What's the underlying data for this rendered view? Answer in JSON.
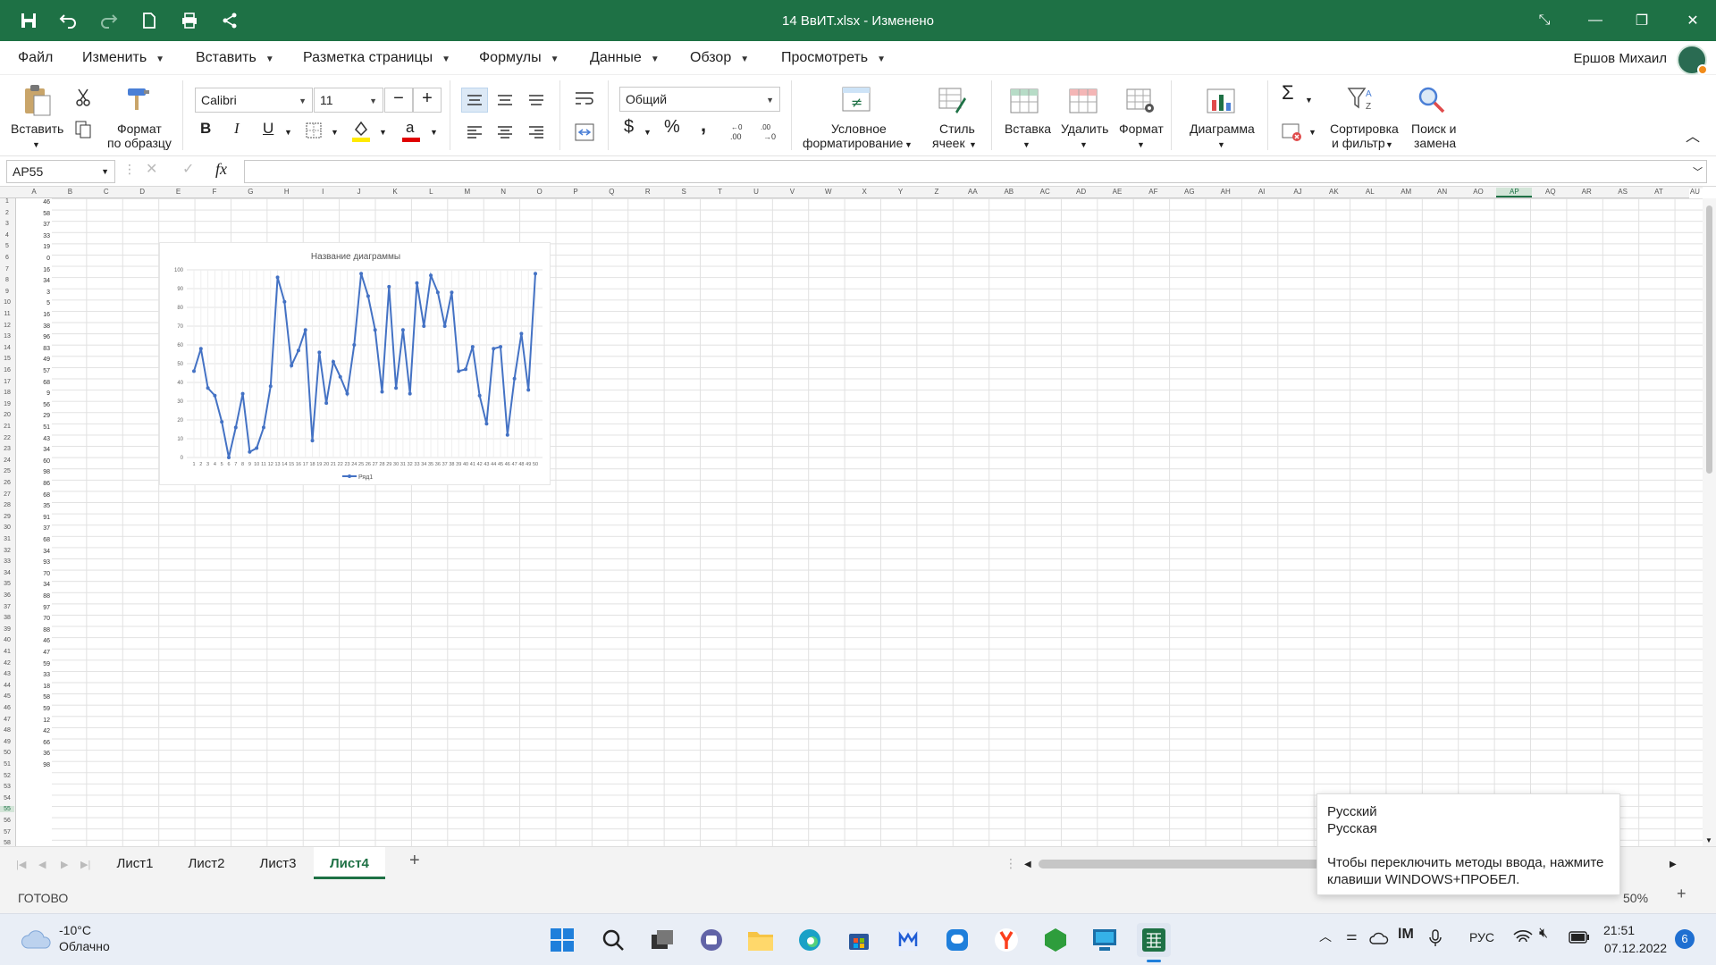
{
  "window": {
    "title": "14 ВвИТ.xlsx - Изменено"
  },
  "menu": {
    "items": [
      "Файл",
      "Изменить",
      "Вставить",
      "Разметка страницы",
      "Формулы",
      "Данные",
      "Обзор",
      "Просмотреть"
    ],
    "user": "Ершов Михаил"
  },
  "ribbon": {
    "paste": "Вставить",
    "format_painter_1": "Формат",
    "format_painter_2": "по образцу",
    "font": "Calibri",
    "font_size": "11",
    "number_format": "Общий",
    "cond_fmt_1": "Условное",
    "cond_fmt_2": "форматирование",
    "cell_style_1": "Стиль",
    "cell_style_2": "ячеек",
    "insert": "Вставка",
    "delete": "Удалить",
    "format": "Формат",
    "chart": "Диаграмма",
    "sort_1": "Сортировка",
    "sort_2": "и фильтр",
    "find_1": "Поиск и",
    "find_2": "замена",
    "currency": "$",
    "percent": "%",
    "comma": ","
  },
  "formula_bar": {
    "name_box": "AP55",
    "fx": "fx",
    "formula": ""
  },
  "sheet": {
    "columns": [
      "A",
      "B",
      "C",
      "D",
      "E",
      "F",
      "G",
      "H",
      "I",
      "J",
      "K",
      "L",
      "M",
      "N",
      "O",
      "P",
      "Q",
      "R",
      "S",
      "T",
      "U",
      "V",
      "W",
      "X",
      "Y",
      "Z",
      "AA",
      "AB",
      "AC",
      "AD",
      "AE",
      "AF",
      "AG",
      "AH",
      "AI",
      "AJ",
      "AK",
      "AL",
      "AM",
      "AN",
      "AO",
      "AP",
      "AQ",
      "AR",
      "AS",
      "AT",
      "AU"
    ],
    "row_numbers": [
      "1",
      "2",
      "3",
      "4",
      "5",
      "6",
      "7",
      "8",
      "9",
      "10",
      "11",
      "12",
      "13",
      "14",
      "15",
      "16",
      "17",
      "18",
      "19",
      "20",
      "21",
      "22",
      "23",
      "24",
      "25",
      "26",
      "27",
      "28",
      "29",
      "30",
      "31",
      "32",
      "33",
      "34",
      "35",
      "36",
      "37",
      "38",
      "39",
      "40",
      "41",
      "42",
      "43",
      "44",
      "45",
      "46",
      "47",
      "48",
      "49",
      "50",
      "51",
      "52",
      "53",
      "54",
      "55",
      "56",
      "57",
      "58"
    ],
    "column_a": [
      "46",
      "58",
      "37",
      "33",
      "19",
      "0",
      "16",
      "34",
      "3",
      "5",
      "16",
      "38",
      "96",
      "83",
      "49",
      "57",
      "68",
      "9",
      "56",
      "29",
      "51",
      "43",
      "34",
      "60",
      "98",
      "86",
      "68",
      "35",
      "91",
      "37",
      "68",
      "34",
      "93",
      "70",
      "34",
      "88",
      "97",
      "70",
      "88",
      "46",
      "47",
      "59",
      "33",
      "18",
      "58",
      "59",
      "12",
      "42",
      "66",
      "36",
      "98"
    ]
  },
  "chart_data": {
    "type": "line",
    "title": "Название диаграммы",
    "x": [
      "1",
      "2",
      "3",
      "4",
      "5",
      "6",
      "7",
      "8",
      "9",
      "10",
      "11",
      "12",
      "13",
      "14",
      "15",
      "16",
      "17",
      "18",
      "19",
      "20",
      "21",
      "22",
      "23",
      "24",
      "25",
      "26",
      "27",
      "28",
      "29",
      "30",
      "31",
      "32",
      "33",
      "34",
      "35",
      "36",
      "37",
      "38",
      "39",
      "40",
      "41",
      "42",
      "43",
      "44",
      "45",
      "46",
      "47",
      "48",
      "49",
      "50"
    ],
    "y_ticks": [
      "0",
      "10",
      "20",
      "30",
      "40",
      "50",
      "60",
      "70",
      "80",
      "90",
      "100"
    ],
    "ylim": [
      0,
      100
    ],
    "series": [
      {
        "name": "Ряд1",
        "values": [
          46,
          58,
          37,
          33,
          19,
          0,
          16,
          34,
          3,
          5,
          16,
          38,
          96,
          83,
          49,
          57,
          68,
          9,
          56,
          29,
          51,
          43,
          34,
          60,
          98,
          86,
          68,
          35,
          91,
          37,
          68,
          34,
          93,
          70,
          97,
          88,
          70,
          88,
          46,
          47,
          59,
          33,
          18,
          58,
          59,
          12,
          42,
          66,
          36,
          98
        ],
        "color": "#4472c4"
      }
    ],
    "grid": true,
    "legend": "bottom"
  },
  "tabs": [
    "Лист1",
    "Лист2",
    "Лист3",
    "Лист4"
  ],
  "status": {
    "ready": "ГОТОВО",
    "zoom": "50%"
  },
  "tooltip": {
    "line1": "Русский",
    "line2": "Русская",
    "line3": "Чтобы переключить методы ввода, нажмите клавиши WINDOWS+ПРОБЕЛ."
  },
  "taskbar": {
    "temp": "-10°C",
    "weather": "Облачно",
    "lang": "РУС",
    "time": "21:51",
    "date": "07.12.2022",
    "badge": "6"
  },
  "colors": {
    "accent": "#1e7145",
    "series": "#4472c4"
  }
}
